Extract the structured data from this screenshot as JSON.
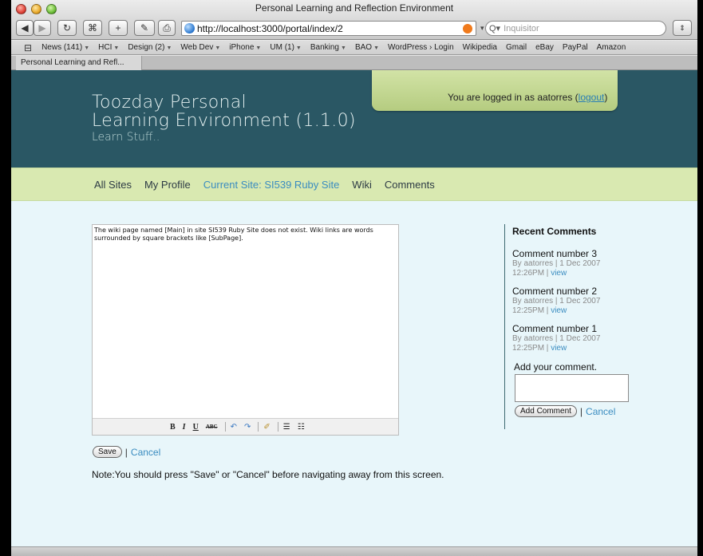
{
  "window": {
    "title": "Personal Learning and Reflection Environment",
    "url": "http://localhost:3000/portal/index/2",
    "search_placeholder": "Inquisitor"
  },
  "bookmarks": [
    {
      "label": "News (141)",
      "menu": true
    },
    {
      "label": "HCI",
      "menu": true
    },
    {
      "label": "Design (2)",
      "menu": true
    },
    {
      "label": "Web Dev",
      "menu": true
    },
    {
      "label": "iPhone",
      "menu": true
    },
    {
      "label": "UM (1)",
      "menu": true
    },
    {
      "label": "Banking",
      "menu": true
    },
    {
      "label": "BAO",
      "menu": true
    },
    {
      "label": "WordPress › Login",
      "menu": false
    },
    {
      "label": "Wikipedia",
      "menu": false
    },
    {
      "label": "Gmail",
      "menu": false
    },
    {
      "label": "eBay",
      "menu": false
    },
    {
      "label": "PayPal",
      "menu": false
    },
    {
      "label": "Amazon",
      "menu": false
    }
  ],
  "tab": {
    "label": "Personal Learning and Refl..."
  },
  "site": {
    "logo_line1": "Toozday Personal",
    "logo_line2": "Learning Environment (1.1.0)",
    "tagline": "Learn Stuff..",
    "login_text": "You are logged in as aatorres (",
    "logout_label": "logout",
    "login_close": ")"
  },
  "nav": [
    {
      "label": "All Sites",
      "active": false
    },
    {
      "label": "My Profile",
      "active": false
    },
    {
      "label": "Current Site: SI539 Ruby Site",
      "active": true
    },
    {
      "label": "Wiki",
      "active": false
    },
    {
      "label": "Comments",
      "active": false
    }
  ],
  "editor": {
    "content": "The wiki page named [Main] in site SI539 Ruby Site does not exist. Wiki links are words surrounded by square brackets like [SubPage].",
    "save_label": "Save",
    "cancel_label": "Cancel",
    "separator": "|"
  },
  "note": "Note:You should press \"Save\" or \"Cancel\" before navigating away from this screen.",
  "sidebar": {
    "heading": "Recent Comments",
    "comments": [
      {
        "title": "Comment number 3",
        "meta": "By aatorres | 1 Dec 2007 12:26PM | ",
        "view": "view"
      },
      {
        "title": "Comment number 2",
        "meta": "By aatorres | 1 Dec 2007 12:25PM | ",
        "view": "view"
      },
      {
        "title": "Comment number 1",
        "meta": "By aatorres | 1 Dec 2007 12:25PM | ",
        "view": "view"
      }
    ],
    "add_label": "Add your comment.",
    "add_button": "Add Comment",
    "cancel_label": "Cancel"
  },
  "colors": {
    "header": "#2a5764",
    "nav_bg": "#d9e9b1",
    "link": "#3a8cc0",
    "page_bg": "#e8f6fa"
  }
}
